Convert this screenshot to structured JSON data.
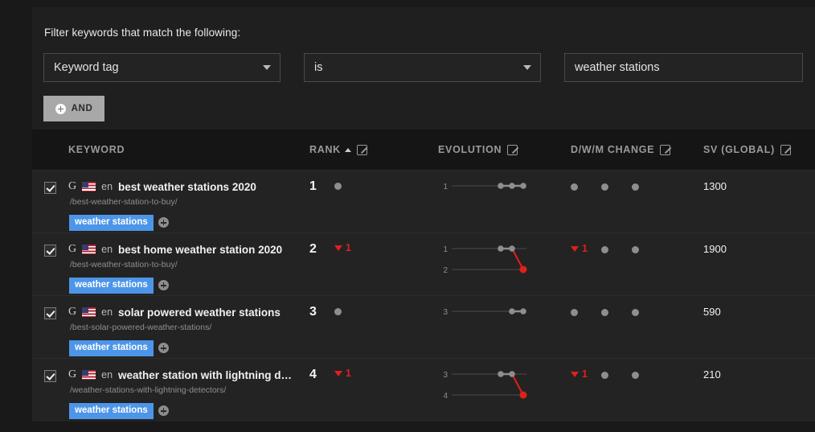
{
  "filter": {
    "title": "Filter keywords that match the following:",
    "field_select": {
      "value": "Keyword tag",
      "icon": "chevron-down-icon"
    },
    "operator_select": {
      "value": "is",
      "icon": "chevron-down-icon"
    },
    "value_input": {
      "value": "weather stations",
      "placeholder": ""
    },
    "and_button": {
      "label": "AND",
      "icon": "plus-circle-icon"
    }
  },
  "table": {
    "headers": {
      "keyword": "KEYWORD",
      "rank": "RANK",
      "rank_sort": "ascending",
      "evolution": "EVOLUTION",
      "change": "D/W/M CHANGE",
      "sv": "SV (GLOBAL)",
      "edit_icon": "edit-icon"
    },
    "rows": [
      {
        "checked": true,
        "engine": "G",
        "flag": "us-flag",
        "lang": "en",
        "keyword": "best weather stations 2020",
        "url": "/best-weather-station-to-buy/",
        "tag": "weather stations",
        "rank": "1",
        "rank_change": null,
        "evolution": {
          "gridlines": [
            "1"
          ],
          "points": [
            1,
            1,
            1
          ],
          "trend": "flat"
        },
        "change_d": null,
        "change_w": null,
        "change_m": null,
        "sv": "1300"
      },
      {
        "checked": true,
        "engine": "G",
        "flag": "us-flag",
        "lang": "en",
        "keyword": "best home weather station 2020",
        "url": "/best-weather-station-to-buy/",
        "tag": "weather stations",
        "rank": "2",
        "rank_change": "1",
        "evolution": {
          "gridlines": [
            "1",
            "2"
          ],
          "points": [
            1,
            1,
            2
          ],
          "trend": "down"
        },
        "change_d": "1",
        "change_w": null,
        "change_m": null,
        "sv": "1900"
      },
      {
        "checked": true,
        "engine": "G",
        "flag": "us-flag",
        "lang": "en",
        "keyword": "solar powered weather stations",
        "url": "/best-solar-powered-weather-stations/",
        "tag": "weather stations",
        "rank": "3",
        "rank_change": null,
        "evolution": {
          "gridlines": [
            "3"
          ],
          "points": [
            3,
            3
          ],
          "trend": "flat"
        },
        "change_d": null,
        "change_w": null,
        "change_m": null,
        "sv": "590"
      },
      {
        "checked": true,
        "engine": "G",
        "flag": "us-flag",
        "lang": "en",
        "keyword": "weather station with lightning dete…",
        "url": "/weather-stations-with-lightning-detectors/",
        "tag": "weather stations",
        "rank": "4",
        "rank_change": "1",
        "evolution": {
          "gridlines": [
            "3",
            "4"
          ],
          "points": [
            3,
            3,
            4
          ],
          "trend": "down"
        },
        "change_d": "1",
        "change_w": null,
        "change_m": null,
        "sv": "210"
      }
    ]
  },
  "colors": {
    "accent_tag": "#4d95e8",
    "down": "#e0201a",
    "neutral_dot": "#8e8e8e",
    "panel": "#1f1f1f",
    "row": "#232323"
  }
}
